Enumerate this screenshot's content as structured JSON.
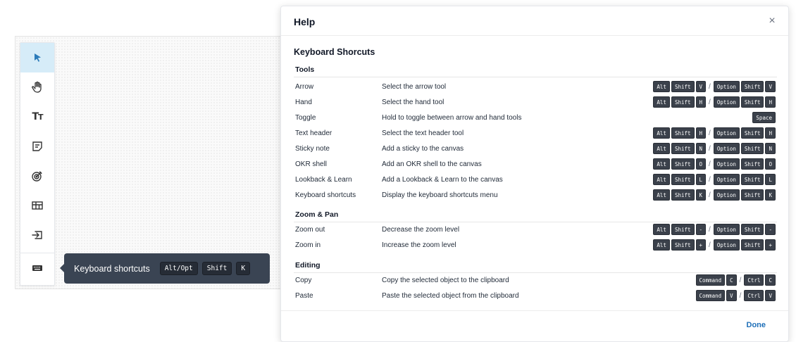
{
  "toolbar": {
    "tools": [
      {
        "name": "arrow",
        "icon": "cursor-arrow-icon"
      },
      {
        "name": "hand",
        "icon": "hand-icon"
      },
      {
        "name": "text-header",
        "icon": "text-header-icon",
        "glyph": "Tт"
      },
      {
        "name": "sticky-note",
        "icon": "sticky-note-icon"
      },
      {
        "name": "okr-shell",
        "icon": "target-icon"
      },
      {
        "name": "lookback-learn",
        "icon": "table-icon"
      },
      {
        "name": "import",
        "icon": "import-icon"
      },
      {
        "name": "keyboard-shortcuts",
        "icon": "keyboard-icon"
      }
    ],
    "active_color": "#d6ecf8"
  },
  "tooltip": {
    "label": "Keyboard shortcuts",
    "keys": [
      "Alt/Opt",
      "Shift",
      "K"
    ]
  },
  "modal": {
    "title": "Help",
    "close": "×",
    "section_title": "Keyboard Shorcuts",
    "done_label": "Done",
    "groups": [
      {
        "title": "Tools",
        "rows": [
          {
            "name": "Arrow",
            "desc": "Select the arrow tool",
            "keys": [
              [
                "Alt",
                "Shift",
                "V"
              ],
              [
                "Option",
                "Shift",
                "V"
              ]
            ]
          },
          {
            "name": "Hand",
            "desc": "Select the hand tool",
            "keys": [
              [
                "Alt",
                "Shift",
                "H"
              ],
              [
                "Option",
                "Shift",
                "H"
              ]
            ]
          },
          {
            "name": "Toggle",
            "desc": "Hold to toggle between arrow and hand tools",
            "keys": [
              [
                "Space"
              ]
            ]
          },
          {
            "name": "Text header",
            "desc": "Select the text header tool",
            "keys": [
              [
                "Alt",
                "Shift",
                "H"
              ],
              [
                "Option",
                "Shift",
                "H"
              ]
            ]
          },
          {
            "name": "Sticky note",
            "desc": "Add a sticky to the canvas",
            "keys": [
              [
                "Alt",
                "Shift",
                "N"
              ],
              [
                "Option",
                "Shift",
                "N"
              ]
            ]
          },
          {
            "name": "OKR shell",
            "desc": "Add an OKR shell to the canvas",
            "keys": [
              [
                "Alt",
                "Shift",
                "O"
              ],
              [
                "Option",
                "Shift",
                "O"
              ]
            ]
          },
          {
            "name": "Lookback & Learn",
            "desc": "Add a Lookback & Learn to the canvas",
            "keys": [
              [
                "Alt",
                "Shift",
                "L"
              ],
              [
                "Option",
                "Shift",
                "L"
              ]
            ]
          },
          {
            "name": "Keyboard shortcuts",
            "desc": "Display the keyboard shortcuts menu",
            "keys": [
              [
                "Alt",
                "Shift",
                "K"
              ],
              [
                "Option",
                "Shift",
                "K"
              ]
            ]
          }
        ]
      },
      {
        "title": "Zoom & Pan",
        "rows": [
          {
            "name": "Zoom out",
            "desc": "Decrease the zoom level",
            "keys": [
              [
                "Alt",
                "Shift",
                "-"
              ],
              [
                "Option",
                "Shift",
                "-"
              ]
            ]
          },
          {
            "name": "Zoom in",
            "desc": "Increase the zoom level",
            "keys": [
              [
                "Alt",
                "Shift",
                "+"
              ],
              [
                "Option",
                "Shift",
                "+"
              ]
            ]
          }
        ]
      },
      {
        "title": "Editing",
        "rows": [
          {
            "name": "Copy",
            "desc": "Copy the selected object to the clipboard",
            "keys": [
              [
                "Command",
                "C"
              ],
              [
                "Ctrl",
                "C"
              ]
            ]
          },
          {
            "name": "Paste",
            "desc": "Paste the selected object from the clipboard",
            "keys": [
              [
                "Command",
                "V"
              ],
              [
                "Ctrl",
                "V"
              ]
            ]
          }
        ]
      }
    ]
  }
}
